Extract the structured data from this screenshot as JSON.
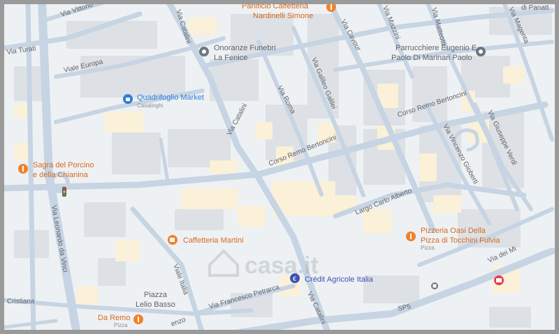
{
  "map": {
    "watermark": "casa.it",
    "colors": {
      "background": "#eef1f3",
      "road": "#c6d4e3",
      "road_edge": "#b5c5d6",
      "building": "#dde1e5",
      "building_beige": "#fbf0d8",
      "food": "#f0822b",
      "shop": "#2f7fd8",
      "grey_poi": "#6c7680",
      "bank": "#3f51b5",
      "hotel": "#e8404b",
      "road_label": "#5f6368"
    }
  },
  "streets": {
    "via_vittorio": "Via Vittorio",
    "via_turati": "Via Turati",
    "viale_europa": "Viale Europa",
    "via_catalini_north": "Via Catalini",
    "via_catalini_mid": "Via Catalini",
    "via_catalini_south": "Via Catalini",
    "via_cavour": "Via Cavour",
    "via_mazzini": "Via Mazzini",
    "via_matteotti": "Via Matteotti",
    "via_magenta": "Via Magenta",
    "via_roma": "Via Roma",
    "via_galileo_galilei": "Via Galileo Galilei",
    "corso_bertoncini_east": "Corso Remo Bertoncini",
    "corso_bertoncini_west": "Corso Remo Bertoncini",
    "largo_carlo_alberto": "Largo Carlo Alberto",
    "via_vincenzo_gioberti": "Via Vincenzo Gioberti",
    "via_giuseppe_verdi": "Via Giuseppe Verdi",
    "via_leonardo_da_vinci": "Via Leonardo da Vinci",
    "viale_italia": "Viale Italia",
    "via_francesco_petrarca": "Via Francesco Petrarca",
    "sp5": "SP5",
    "via_dei_mille": "Via dei Mi",
    "cristiana": "Cristiana",
    "enzo": "enzo",
    "di_panatt": "di Panatt",
    "piazza_lelio_basso": "Piazza\nLelio Basso"
  },
  "pois": {
    "panificio": {
      "name": "Panificio Caffetteria\nNardinelli Simone",
      "icon": "restaurant-icon"
    },
    "onoranze": {
      "name": "Onoranze Funebri\nLa Fenice",
      "icon": "place-icon"
    },
    "parrucchiere": {
      "name": "Parrucchiere Eugenio E\nPaolo Di Marinari Paolo",
      "icon": "place-icon"
    },
    "quadrifoglio": {
      "name": "Quadrifoglio Market",
      "subtitle": "Casalinghi",
      "icon": "shopping-bag-icon"
    },
    "sagra": {
      "name": "Sagra del Porcino\ne della Chianina",
      "icon": "restaurant-icon"
    },
    "caffetteria_martini": {
      "name": "Caffetteria Martini",
      "icon": "cafe-icon"
    },
    "pizzeria": {
      "name": "Pizzeria Oasi Della\nPizza di Tocchini Fulvia",
      "subtitle": "Pizza",
      "icon": "restaurant-icon"
    },
    "credit_agricole": {
      "name": "Crédit Agricole Italia",
      "icon": "bank-icon"
    },
    "da_remo": {
      "name": "Da Remo",
      "subtitle": "Pizza",
      "icon": "restaurant-icon"
    },
    "hotel": {
      "icon": "hotel-icon"
    }
  }
}
